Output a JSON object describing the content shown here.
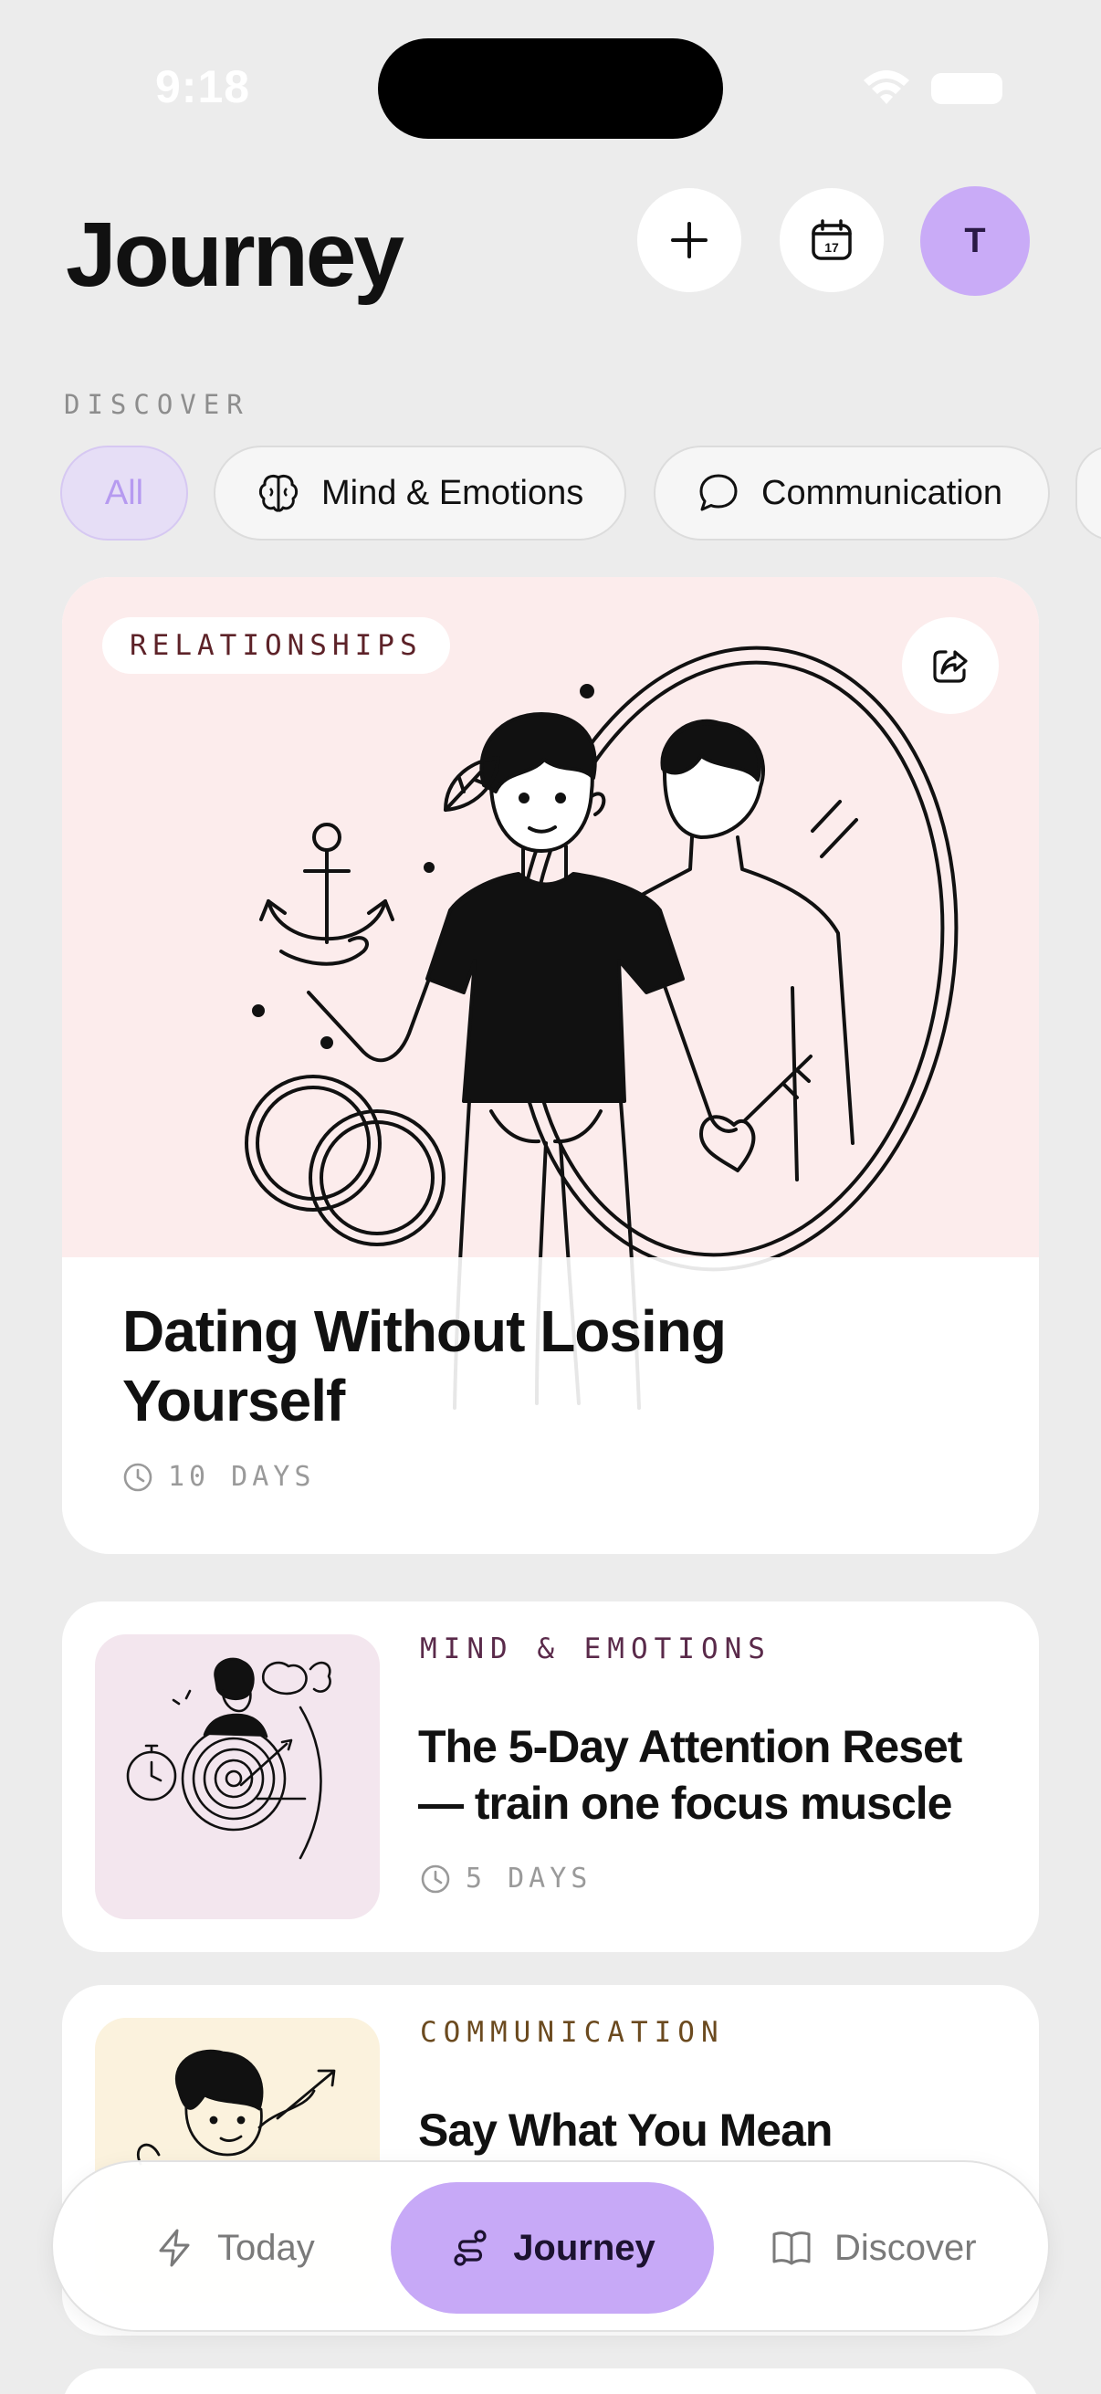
{
  "status_bar": {
    "time": "9:18"
  },
  "header": {
    "title": "Journey",
    "avatar_initial": "T"
  },
  "discover": {
    "label": "DISCOVER",
    "chips": [
      {
        "label": "All",
        "icon": "grid-icon",
        "selected": true
      },
      {
        "label": "Mind & Emotions",
        "icon": "brain-icon"
      },
      {
        "label": "Communication",
        "icon": "speech-bubble-icon"
      }
    ]
  },
  "featured": {
    "category": "RELATIONSHIPS",
    "title": "Dating Without Losing Yourself",
    "duration": "10 DAYS",
    "illustration": "man-mirror-anchor-key-illustration"
  },
  "journeys": [
    {
      "category": "MIND & EMOTIONS",
      "title": "The 5-Day Attention Reset — train one focus muscle",
      "duration": "5 DAYS",
      "category_color": "#5a2a4a"
    },
    {
      "category": "COMMUNICATION",
      "title": "Say What You Mean",
      "category_color": "#6b4a1f"
    }
  ],
  "tabbar": {
    "tabs": [
      {
        "label": "Today",
        "icon": "bolt-icon"
      },
      {
        "label": "Journey",
        "icon": "route-icon",
        "active": true
      },
      {
        "label": "Discover",
        "icon": "book-icon"
      }
    ]
  },
  "colors": {
    "accent": "#c7a9f7",
    "background": "#ececec",
    "featured_bg": "#fcecec"
  }
}
